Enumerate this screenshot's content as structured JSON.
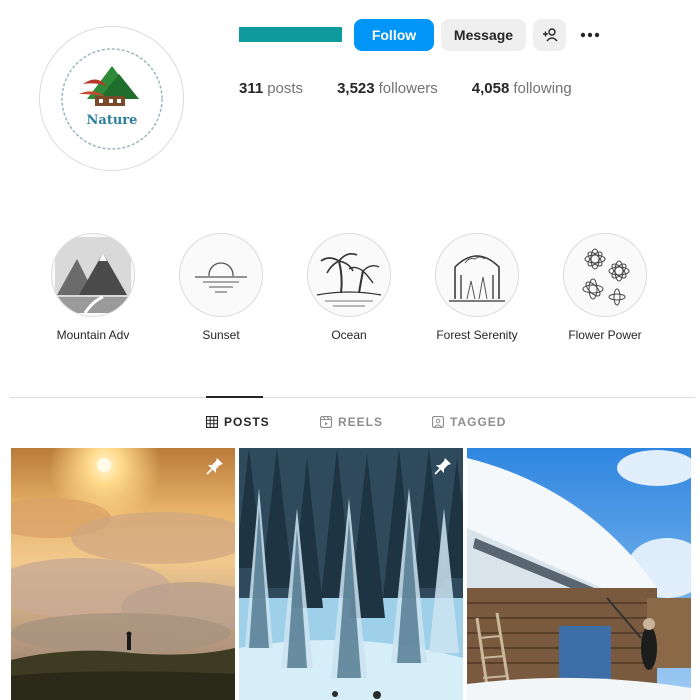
{
  "profile": {
    "avatar_text": "Nature",
    "buttons": {
      "follow": "Follow",
      "message": "Message"
    },
    "stats": [
      {
        "value": "311",
        "label": "posts"
      },
      {
        "value": "3,523",
        "label": "followers"
      },
      {
        "value": "4,058",
        "label": "following"
      }
    ]
  },
  "highlights": [
    {
      "label": "Mountain Adv",
      "icon": "mountain-icon"
    },
    {
      "label": "Sunset",
      "icon": "sunset-icon"
    },
    {
      "label": "Ocean",
      "icon": "palm-icon"
    },
    {
      "label": "Forest Serenity",
      "icon": "forest-icon"
    },
    {
      "label": "Flower Power",
      "icon": "flower-icon"
    }
  ],
  "tabs": [
    {
      "label": "POSTS",
      "active": true
    },
    {
      "label": "REELS",
      "active": false
    },
    {
      "label": "TAGGED",
      "active": false
    }
  ],
  "posts": [
    {
      "subject": "sunset over clouds with hiker",
      "pinned": true
    },
    {
      "subject": "snowy forest",
      "pinned": true
    },
    {
      "subject": "snow-covered cabin",
      "pinned": false
    }
  ],
  "colors": {
    "follow": "#0095f6",
    "username_bar": "#0f9a9e"
  }
}
